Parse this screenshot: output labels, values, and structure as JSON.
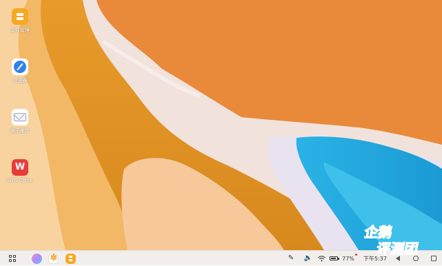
{
  "desktop": {
    "icons": [
      {
        "name": "files",
        "label": "文件管理"
      },
      {
        "name": "browser",
        "label": "浏览器"
      },
      {
        "name": "mail",
        "label": "电子邮件"
      },
      {
        "name": "wps",
        "label": "WPS Office",
        "glyph": "W"
      }
    ]
  },
  "taskbar": {
    "launcher_icon": "app-grid-icon",
    "pinned_apps": [
      "assistant-app-icon",
      "gallery-app-icon",
      "files-app-icon"
    ],
    "tray": {
      "pen_icon": "✎",
      "volume_icon": "🔈",
      "wifi_icon": "wifi-icon",
      "battery_percent": "77%",
      "time": "下午5:37"
    }
  },
  "colors": {
    "taskbar_bg": "#f1eeeb",
    "wallpaper_orange": "#e88a3a",
    "wallpaper_blue": "#23a0d6"
  }
}
